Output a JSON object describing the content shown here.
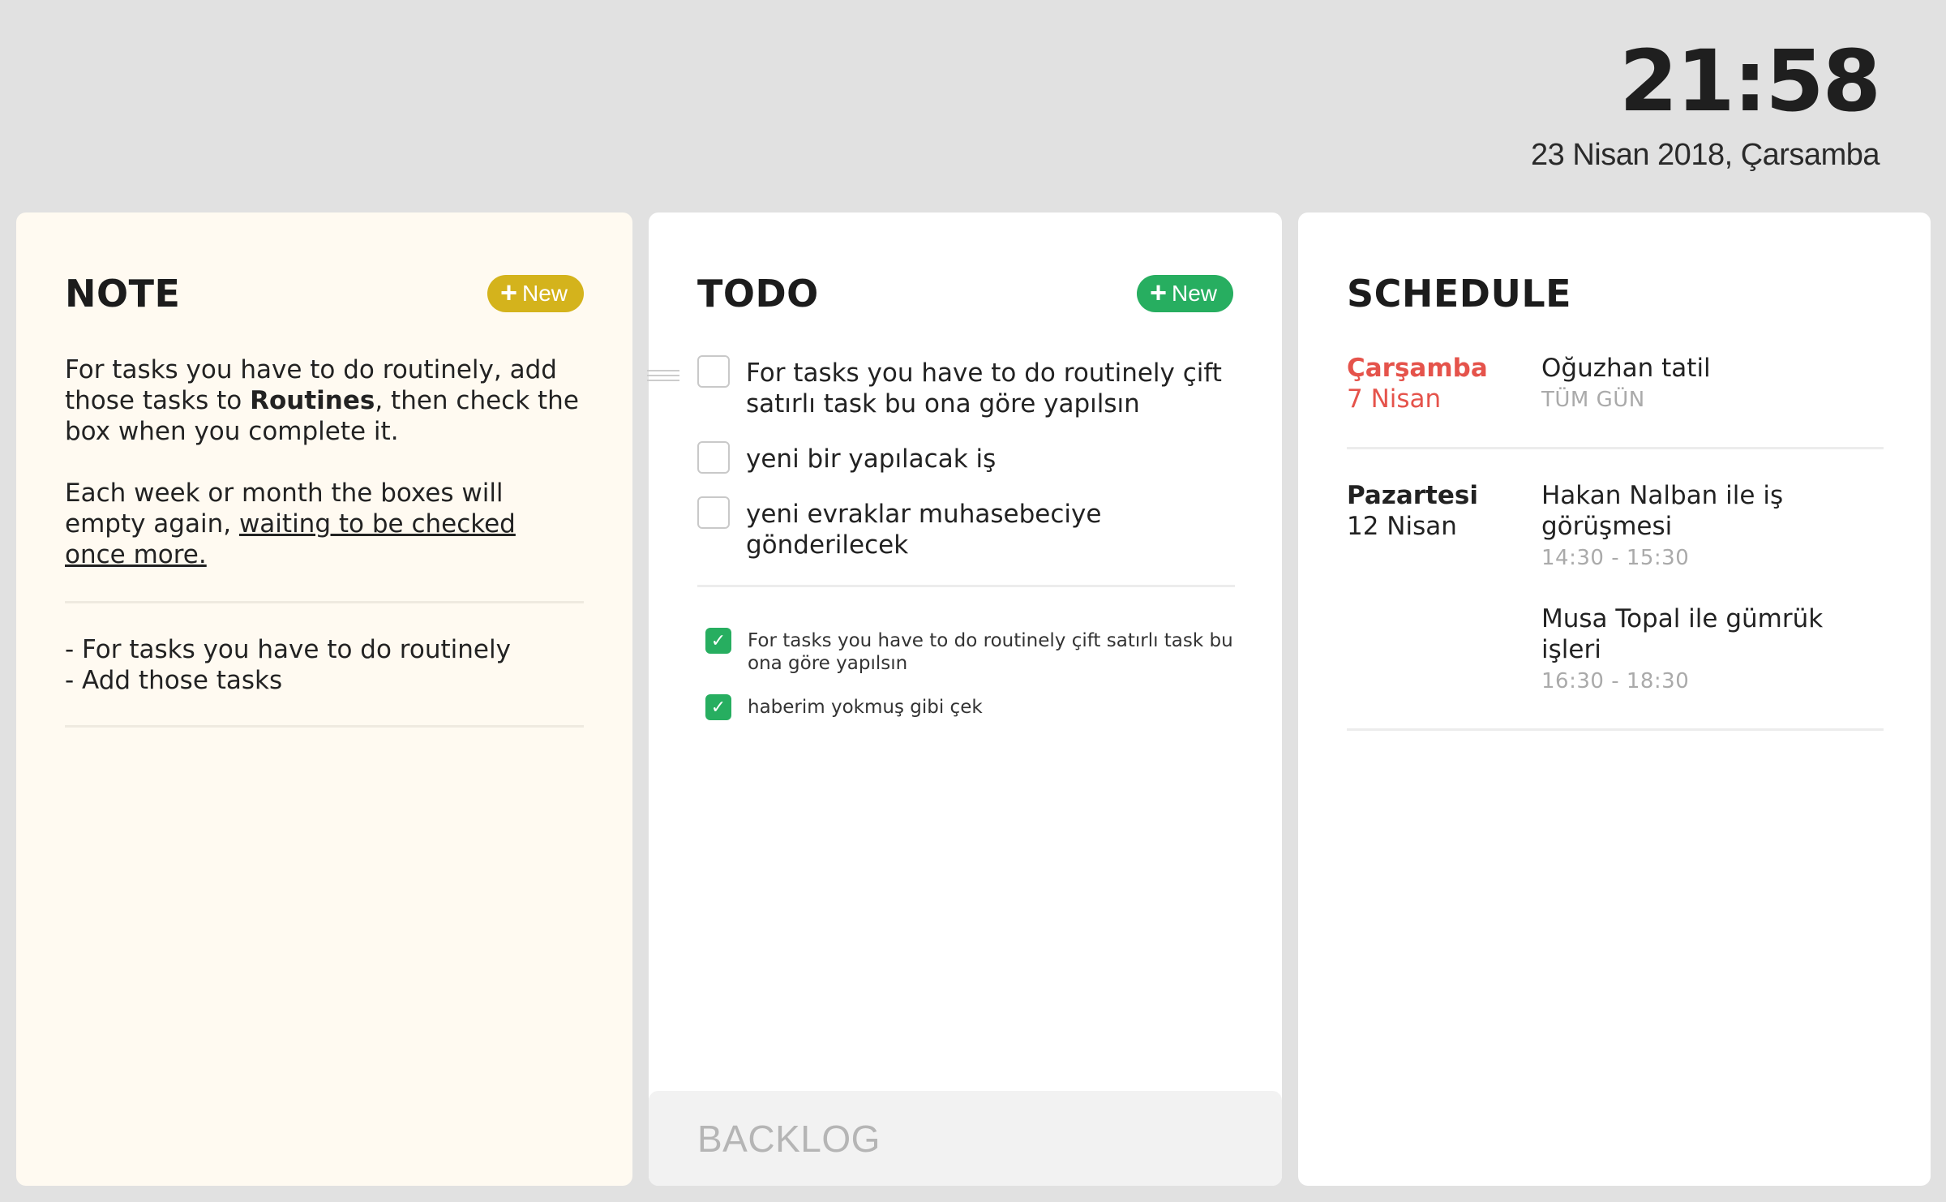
{
  "clock": {
    "time": "21:58",
    "date": "23 Nisan 2018, Çarsamba"
  },
  "note": {
    "title": "NOTE",
    "new_label": "New",
    "accent": "#d4b31c",
    "paragraph1_a": "For tasks you have to do routinely, add those tasks to ",
    "paragraph1_bold": "Routines",
    "paragraph1_b": ", then check the box when you complete it.",
    "paragraph2_a": "Each week or month the boxes will empty again, ",
    "paragraph2_link": "waiting to be checked once more.",
    "list": [
      "- For tasks you have to do routinely",
      "- Add those tasks"
    ]
  },
  "todo": {
    "title": "TODO",
    "new_label": "New",
    "accent": "#27ae60",
    "items": [
      "For tasks you have to do routinely çift satırlı task bu ona göre yapılsın",
      "yeni bir yapılacak iş",
      "yeni evraklar muhasebeciye gönderilecek"
    ],
    "done": [
      "For tasks you have to do routinely çift satırlı task bu ona göre yapılsın",
      "haberim yokmuş gibi çek"
    ],
    "backlog_label": "BACKLOG"
  },
  "schedule": {
    "title": "SCHEDULE",
    "today_color": "#e5534b",
    "groups": [
      {
        "day": "Çarşamba",
        "date": "7 Nisan",
        "events": [
          {
            "title": "Oğuzhan tatil",
            "time": "TÜM GÜN"
          }
        ]
      },
      {
        "day": "Pazartesi",
        "date": "12 Nisan",
        "events": [
          {
            "title": "Hakan Nalban ile iş görüşmesi",
            "time": "14:30 - 15:30"
          },
          {
            "title": "Musa Topal ile gümrük işleri",
            "time": "16:30 - 18:30"
          }
        ]
      }
    ]
  }
}
